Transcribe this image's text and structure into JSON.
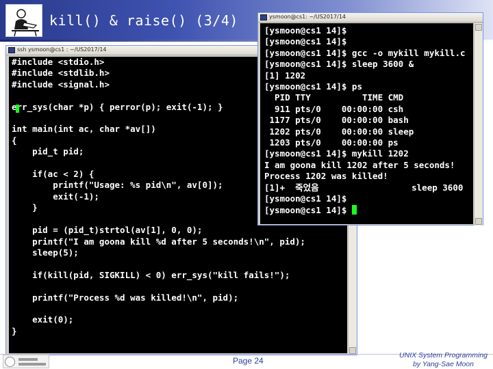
{
  "slide": {
    "title": "kill() & raise() (3/4)",
    "page_number": "Page 24",
    "course_line1": "UNIX System Programming",
    "course_line2": "by Yang-Sae Moon"
  },
  "icons": {
    "header_logo": "reading-person-icon",
    "footer_logo": "university-seal-icon"
  },
  "code_window": {
    "title": "ssh ysmoon@cs1 : ~/US2017/14",
    "code_lines": [
      "#include <stdio.h>",
      "#include <stdlib.h>",
      "#include <signal.h>",
      "",
      "err_sys(char *p) { perror(p); exit(-1); }",
      "",
      "int main(int ac, char *av[])",
      "{",
      "    pid_t pid;",
      "",
      "    if(ac < 2) {",
      "        printf(\"Usage: %s pid\\n\", av[0]);",
      "        exit(-1);",
      "    }",
      "",
      "    pid = (pid_t)strtol(av[1], 0, 0);",
      "    printf(\"I am goona kill %d after 5 seconds!\\n\", pid);",
      "    sleep(5);",
      "",
      "    if(kill(pid, SIGKILL) < 0) err_sys(\"kill fails!\");",
      "",
      "    printf(\"Process %d was killed!\\n\", pid);",
      "",
      "    exit(0);",
      "}"
    ]
  },
  "shell_window": {
    "title": "ysmoon@cs1: ~/US2017/14",
    "lines": [
      "[ysmoon@cs1 14]$",
      "[ysmoon@cs1 14]$",
      "[ysmoon@cs1 14]$ gcc -o mykill mykill.c",
      "[ysmoon@cs1 14]$ sleep 3600 &",
      "[1] 1202",
      "[ysmoon@cs1 14]$ ps",
      "  PID TTY          TIME CMD",
      "  911 pts/0    00:00:00 csh",
      " 1177 pts/0    00:00:00 bash",
      " 1202 pts/0    00:00:00 sleep",
      " 1203 pts/0    00:00:00 ps",
      "[ysmoon@cs1 14]$ mykill 1202",
      "I am goona kill 1202 after 5 seconds!",
      "Process 1202 was killed!",
      "[1]+  죽었음                  sleep 3600",
      "[ysmoon@cs1 14]$",
      "[ysmoon@cs1 14]$ "
    ]
  }
}
